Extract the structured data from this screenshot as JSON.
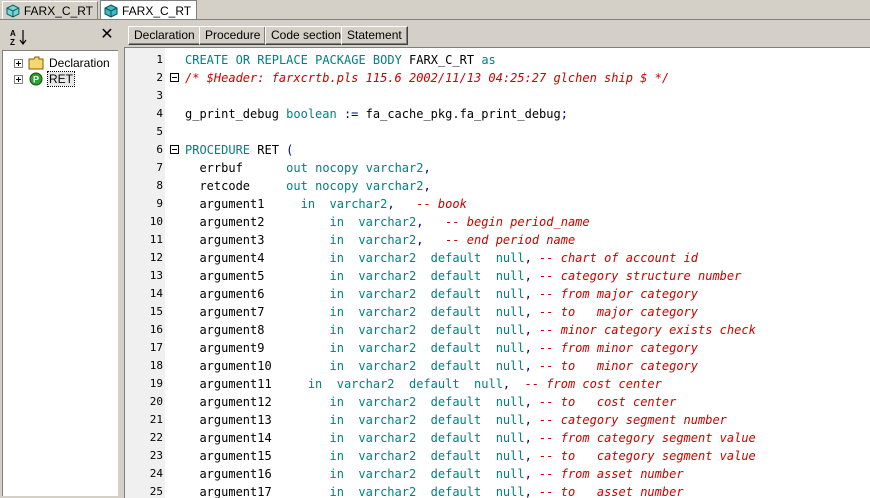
{
  "tabs": [
    {
      "label": "FARX_C_RT",
      "active": false,
      "icon": "package-icon"
    },
    {
      "label": "FARX_C_RT",
      "active": true,
      "icon": "package-body-icon"
    }
  ],
  "left_panel": {
    "sort_icon": "sort-az-icon",
    "close_icon": "close-icon",
    "tree": [
      {
        "label": "Declaration",
        "icon": "folder-icon",
        "selected": false
      },
      {
        "label": "RET",
        "icon": "procedure-icon",
        "selected": true
      }
    ]
  },
  "toolbar": {
    "buttons": [
      "Declaration",
      "Procedure",
      "Code section",
      "Statement"
    ]
  },
  "editor": {
    "colors": {
      "keyword": "#008080",
      "identifier": "#000080",
      "comment": "#cc0000"
    },
    "lines": [
      {
        "n": "1",
        "fold": false,
        "text": "CREATE OR REPLACE PACKAGE BODY FARX_C_RT as"
      },
      {
        "n": "2",
        "fold": true,
        "text": "/* $Header: farxcrtb.pls 115.6 2002/11/13 04:25:27 glchen ship $ */"
      },
      {
        "n": "3",
        "fold": false,
        "text": ""
      },
      {
        "n": "4",
        "fold": false,
        "text": "g_print_debug boolean := fa_cache_pkg.fa_print_debug;"
      },
      {
        "n": "5",
        "fold": false,
        "text": ""
      },
      {
        "n": "6",
        "fold": true,
        "text": "PROCEDURE RET ("
      },
      {
        "n": "7",
        "fold": false,
        "text": "  errbuf      out nocopy varchar2,"
      },
      {
        "n": "8",
        "fold": false,
        "text": "  retcode     out nocopy varchar2,"
      },
      {
        "n": "9",
        "fold": false,
        "text": "  argument1     in  varchar2,   -- book"
      },
      {
        "n": "10",
        "fold": false,
        "text": "  argument2         in  varchar2,   -- begin period_name"
      },
      {
        "n": "11",
        "fold": false,
        "text": "  argument3         in  varchar2,   -- end period name"
      },
      {
        "n": "12",
        "fold": false,
        "text": "  argument4         in  varchar2  default  null, -- chart of account id"
      },
      {
        "n": "13",
        "fold": false,
        "text": "  argument5         in  varchar2  default  null, -- category structure number"
      },
      {
        "n": "14",
        "fold": false,
        "text": "  argument6         in  varchar2  default  null, -- from major category"
      },
      {
        "n": "15",
        "fold": false,
        "text": "  argument7         in  varchar2  default  null, -- to   major category"
      },
      {
        "n": "16",
        "fold": false,
        "text": "  argument8         in  varchar2  default  null, -- minor category exists check"
      },
      {
        "n": "17",
        "fold": false,
        "text": "  argument9         in  varchar2  default  null, -- from minor category"
      },
      {
        "n": "18",
        "fold": false,
        "text": "  argument10        in  varchar2  default  null, -- to   minor category"
      },
      {
        "n": "19",
        "fold": false,
        "text": "  argument11     in  varchar2  default  null,  -- from cost center"
      },
      {
        "n": "20",
        "fold": false,
        "text": "  argument12        in  varchar2  default  null, -- to   cost center"
      },
      {
        "n": "21",
        "fold": false,
        "text": "  argument13        in  varchar2  default  null, -- category segment number"
      },
      {
        "n": "22",
        "fold": false,
        "text": "  argument14        in  varchar2  default  null, -- from category segment value"
      },
      {
        "n": "23",
        "fold": false,
        "text": "  argument15        in  varchar2  default  null, -- to   category segment value"
      },
      {
        "n": "24",
        "fold": false,
        "text": "  argument16        in  varchar2  default  null, -- from asset number"
      },
      {
        "n": "25",
        "fold": false,
        "text": "  argument17        in  varchar2  default  null, -- to   asset number"
      }
    ]
  }
}
